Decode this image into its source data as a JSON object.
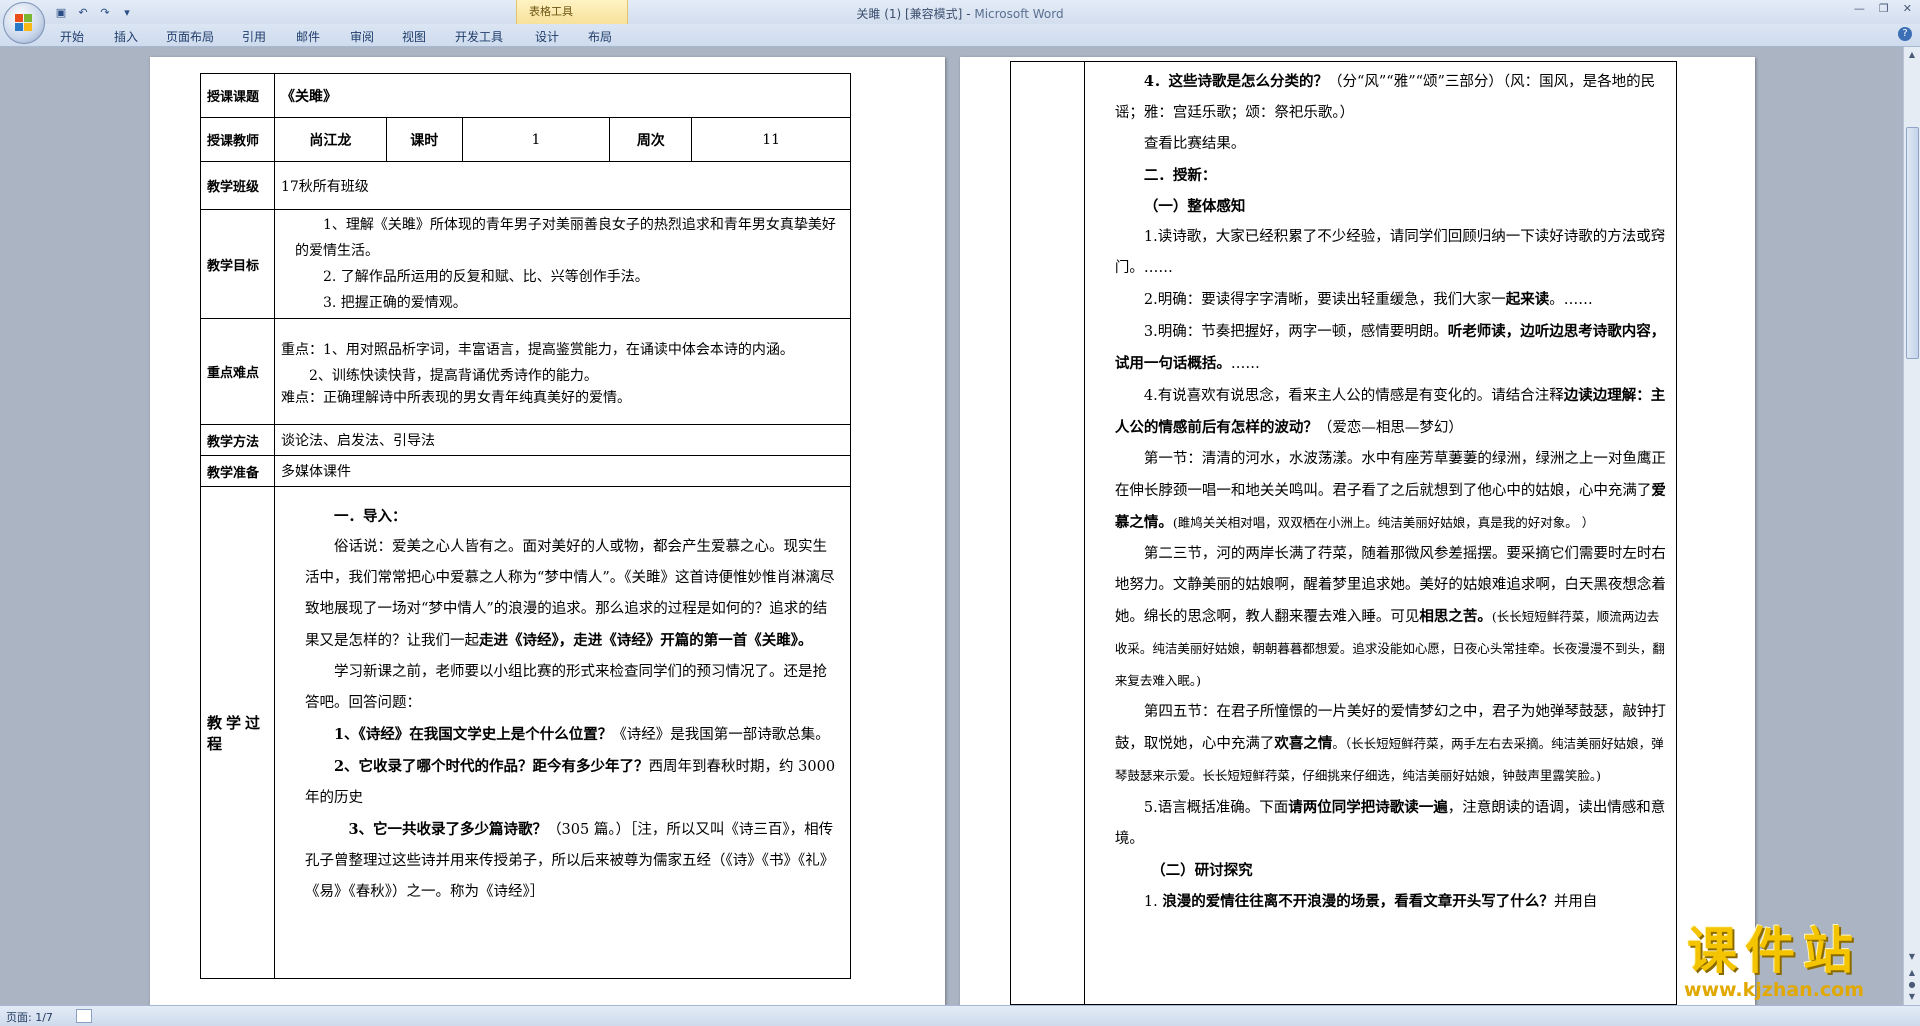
{
  "window": {
    "doc_name": "关雎 (1) [兼容模式]",
    "separator": " - ",
    "app_name": "Microsoft Word",
    "contextual_group": "表格工具"
  },
  "ribbon_tabs": [
    "开始",
    "插入",
    "页面布局",
    "引用",
    "邮件",
    "审阅",
    "视图",
    "开发工具",
    "设计",
    "布局"
  ],
  "status": {
    "page_info": "页面: 1/7"
  },
  "watermark": {
    "title": "课件站",
    "url": "www.kjzhan.com"
  },
  "lesson": {
    "topic_label": "授课课题",
    "topic": "《关雎》",
    "teacher_label": "授课教师",
    "teacher": "尚江龙",
    "hours_label": "课时",
    "hours": "1",
    "week_label": "周次",
    "week": "11",
    "class_label": "教学班级",
    "class": "17秋所有班级",
    "goals_label": "教学目标",
    "goals": [
      "1、理解《关雎》所体现的青年男子对美丽善良女子的热烈追求和青年男女真挚美好的爱情生活。",
      "2. 了解作品所运用的反复和赋、比、兴等创作手法。",
      "3. 把握正确的爱情观。"
    ],
    "key_label": "重点难点",
    "key_points": [
      "重点：1、用对照品析字词，丰富语言，提高鉴赏能力，在诵读中体会本诗的内涵。",
      "2、训练快读快背，提高背诵优秀诗作的能力。",
      "难点：正确理解诗中所表现的男女青年纯真美好的爱情。"
    ],
    "method_label": "教学方法",
    "method": "谈论法、启发法、引导法",
    "prep_label": "教学准备",
    "prep": "多媒体课件",
    "process_label": "教学过程"
  },
  "process_p1": {
    "heading": "一．导入：",
    "intro_1": "俗话说：爱美之心人皆有之。面对美好的人或物，都会产生爱慕之心。现实生活中，我们常常把心中爱慕之人称为“梦中情人”。《关雎》这首诗便惟妙惟肖淋漓尽致地展现了一场对“梦中情人”的浪漫的追求。那么追求的过程是如何的？追求的结果又是怎样的？让我们一起",
    "intro_bold": "走进《诗经》，走进《诗经》开篇的第一首《关雎》。",
    "intro_2": "学习新课之前，老师要以小组比赛的形式来检查同学们的预习情况了。还是抢答吧。回答问题：",
    "q1": "1、《诗经》在我国文学史上是个什么位置？",
    "a1": "《诗经》是我国第一部诗歌总集。",
    "q2": "2、它收录了哪个时代的作品？距今有多少年了？",
    "a2": "西周年到春秋时期，约 3000 年的历史",
    "q3": "3、它一共收录了多少篇诗歌？",
    "a3": "（305 篇。）［注，所以又叫《诗三百》，相传孔子曾整理过这些诗并用来传授弟子，所以后来被尊为儒家五经（《诗》《书》《礼》《易》《春秋》）之一。称为《诗经》］"
  },
  "process_p2": {
    "q4": "4．这些诗歌是怎么分类的？",
    "a4": "（分“风”“雅”“颂”三部分）（风：国风，是各地的民谣；雅：宫廷乐歌；颂：祭祀乐歌。）",
    "result": "查看比赛结果。",
    "sec2": "二．授新：",
    "sub1": "（一）整体感知",
    "r1": "1.读诗歌，大家已经积累了不少经验，请同学们回顾归纳一下读好诗歌的方法或窍门。……",
    "r2a": "2.明确：要读得字字清晰，要读出轻重缓急，我们大家一",
    "r2b": "起来读",
    "r2c": "。……",
    "r3a": "3.明确：节奏把握好，两字一顿，感情要明朗。",
    "r3b": "听老师读，边听边思考诗歌内容，试用一句话概括。",
    "r3c": "……",
    "r4a": "4.有说喜欢有说思念，看来主人公的情感是有变化的。请结合注释",
    "r4b": "边读边理解：主人公的情感前后有怎样的波动？",
    "r4c": "（爱恋—相思—梦幻）",
    "s1a": "第一节：清清的河水，水波荡漾。水中有座芳草萋萋的绿洲，绿洲之上一对鱼鹰正在伸长脖颈一唱一和地关关鸣叫。君子看了之后就想到了他心中的姑娘，心中充满了",
    "s1b": "爱慕之情。",
    "s1c": "(雎鸠关关相对唱，双双栖在小洲上。纯洁美丽好姑娘，真是我的好对象。  ）",
    "s2a": "第二三节，河的两岸长满了荇菜，随着那微风参差摇摆。要采摘它们需要时左时右地努力。文静美丽的姑娘啊，醒着梦里追求她。美好的姑娘难追求啊，白天黑夜想念着她。绵长的思念啊，教人翻来覆去难入睡。可见",
    "s2b": "相思之苦。",
    "s2c": "(长长短短鲜荇菜，顺流两边去收采。纯洁美丽好姑娘，朝朝暮暮都想爱。追求没能如心愿，日夜心头常挂牵。长夜漫漫不到头，翻来复去难入眠。)",
    "s3a": "第四五节：在君子所憧憬的一片美好的爱情梦幻之中，君子为她弹琴鼓瑟，敲钟打鼓，取悦她，心中充满了",
    "s3b": "欢喜之情",
    "s3c": "。（长长短短鲜荇菜，两手左右去采摘。纯洁美丽好姑娘，弹琴鼓瑟来示爱。长长短短鲜荇菜，仔细挑来仔细选，纯洁美丽好姑娘，钟鼓声里露笑脸。)",
    "r5a": "5.语言概括准确。下面",
    "r5b": "请两位同学把诗歌读一遍",
    "r5c": "，注意朗读的语调，读出情感和意境。",
    "sub2": "（二）研讨探究",
    "r6a": "1. ",
    "r6b": "浪漫的爱情往往离不开浪漫的场景，看看文章开头写了什么？",
    "r6c": "并用自"
  }
}
